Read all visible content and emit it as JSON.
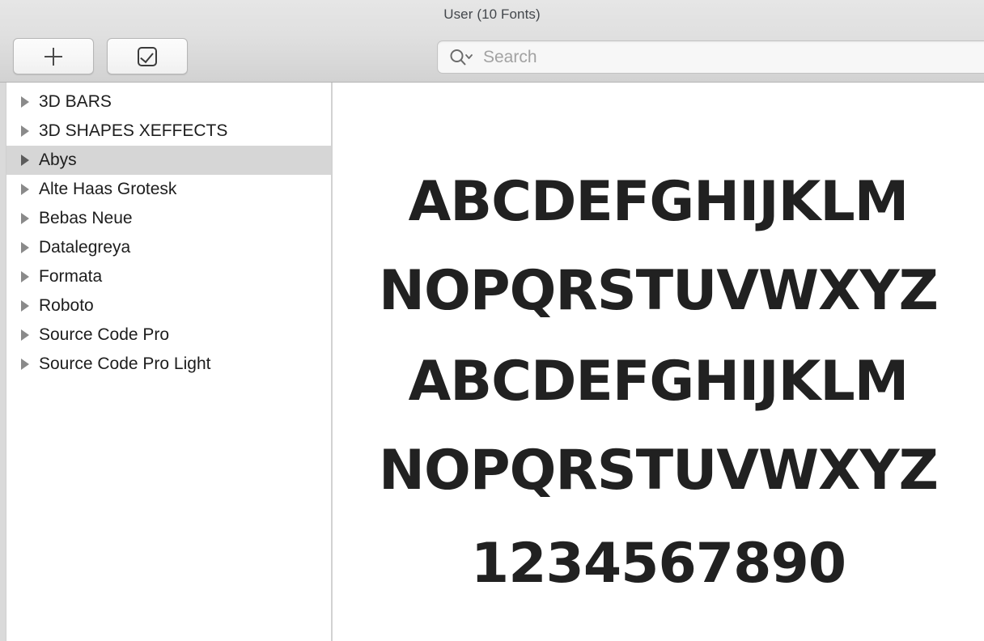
{
  "window": {
    "title": "User (10 Fonts)"
  },
  "toolbar": {
    "add_button_label": "+",
    "add_button_icon": "plus-icon",
    "validate_button_icon": "checkbox-checkmark-icon"
  },
  "search": {
    "placeholder": "Search",
    "value": "",
    "icon": "magnifier-with-chevron-icon"
  },
  "sidebar": {
    "selected_index": 2,
    "items": [
      {
        "label": "3D BARS",
        "expanded": false
      },
      {
        "label": "3D SHAPES XEFFECTS",
        "expanded": false
      },
      {
        "label": "Abys",
        "expanded": false
      },
      {
        "label": "Alte Haas Grotesk",
        "expanded": false
      },
      {
        "label": "Bebas Neue",
        "expanded": false
      },
      {
        "label": "Datalegreya",
        "expanded": false
      },
      {
        "label": "Formata",
        "expanded": false
      },
      {
        "label": "Roboto",
        "expanded": false
      },
      {
        "label": "Source Code Pro",
        "expanded": false
      },
      {
        "label": "Source Code Pro Light",
        "expanded": false
      }
    ]
  },
  "preview": {
    "font_name": "Abys",
    "lines": [
      "ABCDEFGHIJKLM",
      "NOPQRSTUVWXYZ",
      "ABCDEFGHIJKLM",
      "NOPQRSTUVWXYZ",
      "1234567890"
    ]
  },
  "colors": {
    "toolbar_top": "#e6e6e6",
    "toolbar_bottom": "#d2d2d2",
    "selection": "#d6d6d6",
    "text": "#1d1d1d",
    "title_text": "#43474c",
    "placeholder": "#a2a2a2",
    "specimen_ink": "#212121",
    "divider": "#d2d2d2"
  }
}
